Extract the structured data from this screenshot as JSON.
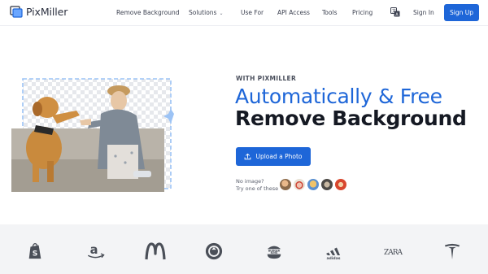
{
  "header": {
    "logo_text": "PixMiller",
    "nav": [
      {
        "label": "Remove Background",
        "has_dropdown": false
      },
      {
        "label": "Solutions",
        "has_dropdown": true
      },
      {
        "label": "Use For",
        "has_dropdown": false
      },
      {
        "label": "API Access",
        "has_dropdown": false
      },
      {
        "label": "Tools",
        "has_dropdown": false
      },
      {
        "label": "Pricing",
        "has_dropdown": false
      }
    ],
    "language_icon": "translate-icon",
    "signin_label": "Sign In",
    "signup_label": "Sign Up"
  },
  "hero": {
    "eyebrow": "WITH PIXMILLER",
    "headline_line1": "Automatically & Free",
    "headline_line2": "Remove Background",
    "upload_label": "Upload a Photo",
    "no_image_line1": "No image?",
    "no_image_line2": "Try one of these",
    "sample_images": [
      "sample-1",
      "sample-2",
      "sample-3",
      "sample-4",
      "sample-5"
    ]
  },
  "brands": [
    "shopify-logo",
    "amazon-logo",
    "mcdonalds-logo",
    "starbucks-logo",
    "burger-king-logo",
    "adidas-logo",
    "zara-logo",
    "tesla-logo"
  ],
  "brand_text": {
    "burger_king_top": "BURGER",
    "burger_king_bottom": "KING",
    "adidas": "adidas",
    "zara": "ZARA"
  },
  "colors": {
    "accent": "#1e66d8",
    "headline_dark": "#151923",
    "brand_strip_bg": "#f3f4f6"
  }
}
